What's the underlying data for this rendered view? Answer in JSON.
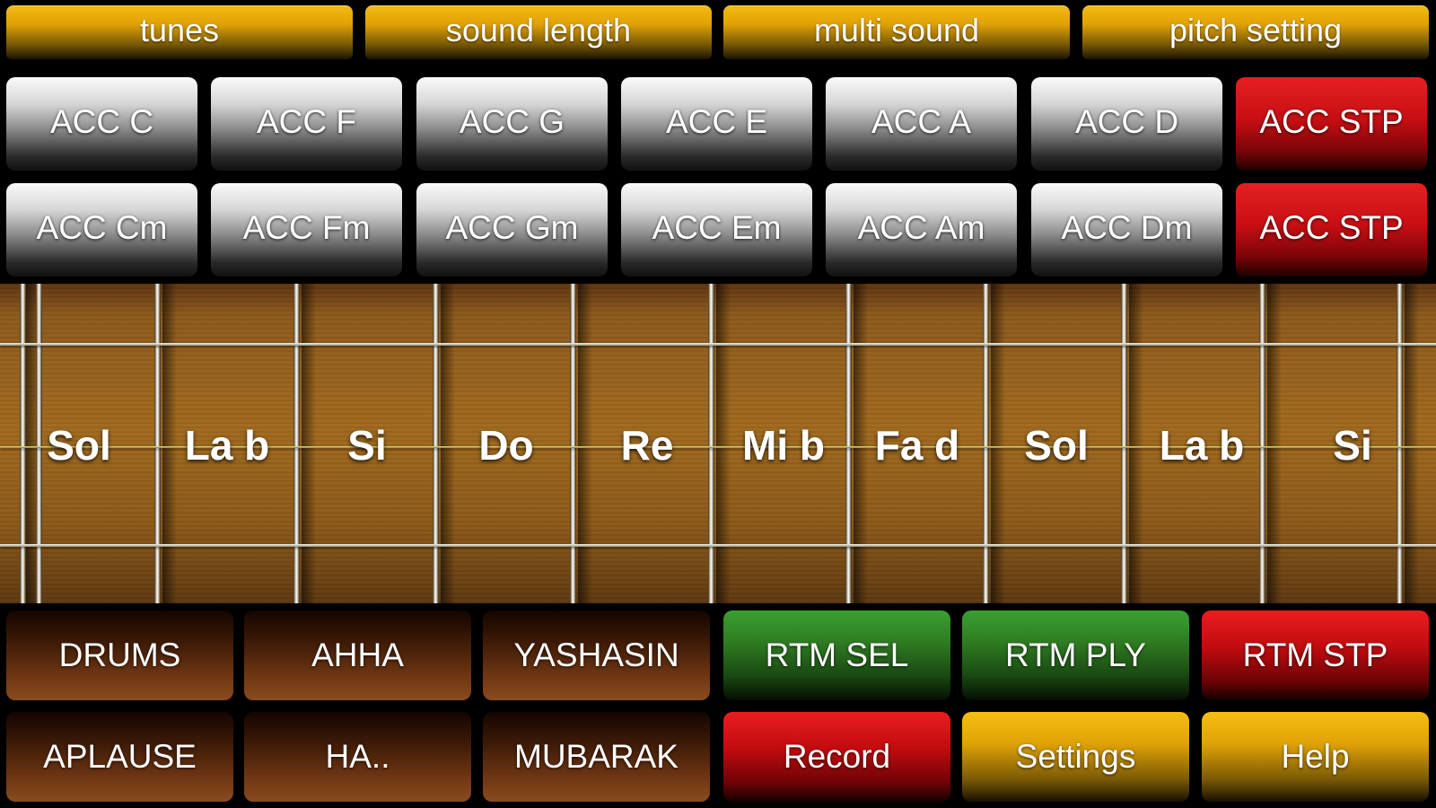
{
  "tabs": [
    "tunes",
    "sound length",
    "multi sound",
    "pitch setting"
  ],
  "chords_major": [
    "ACC C",
    "ACC F",
    "ACC G",
    "ACC E",
    "ACC A",
    "ACC D",
    "ACC STP"
  ],
  "chords_minor": [
    "ACC Cm",
    "ACC Fm",
    "ACC Gm",
    "ACC Em",
    "ACC Am",
    "ACC Dm",
    "ACC STP"
  ],
  "notes": [
    "Sol",
    "La b",
    "Si",
    "Do",
    "Re",
    "Mi b",
    "Fa d",
    "Sol",
    "La b",
    "Si"
  ],
  "sounds_row1": [
    "DRUMS",
    "AHHA",
    "YASHASIN"
  ],
  "sounds_row2": [
    "APLAUSE",
    "HA..",
    "MUBARAK"
  ],
  "rhythm": {
    "select": "RTM SEL",
    "play": "RTM PLY",
    "stop": "RTM STP"
  },
  "actions": {
    "record": "Record",
    "settings": "Settings",
    "help": "Help"
  },
  "colors": {
    "gold": "#e0a106",
    "red": "#c70f14",
    "green": "#2f7c22",
    "brown": "#6b3412",
    "silver": "#d7d7d7"
  }
}
